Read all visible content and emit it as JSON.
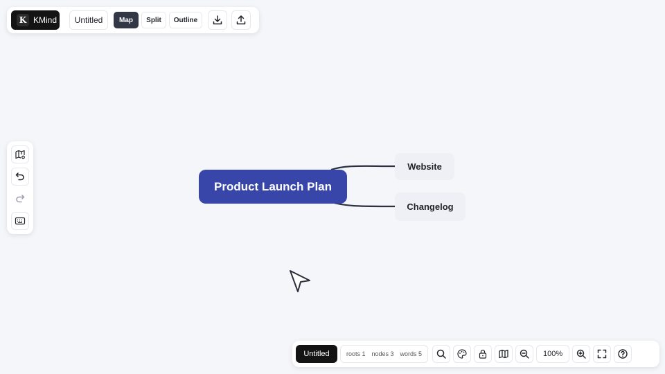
{
  "toolbar": {
    "brand_letter": "K",
    "brand_name": "KMind",
    "doc_title": "Untitled",
    "views": [
      "Map",
      "Split",
      "Outline"
    ],
    "active_view": "Map",
    "download_icon": "download-icon",
    "upload_icon": "upload-icon"
  },
  "left_toolbar": {
    "icons": [
      "map-settings-icon",
      "undo-icon",
      "redo-icon",
      "keyboard-icon"
    ]
  },
  "mindmap": {
    "root": "Product Launch Plan",
    "children": [
      "Website",
      "Changelog"
    ]
  },
  "bottom_bar": {
    "file_name": "Untitled",
    "stats": {
      "roots": "roots 1",
      "nodes": "nodes 3",
      "words": "words 5"
    },
    "zoom": "100%",
    "icons": [
      "search-icon",
      "palette-icon",
      "lock-icon",
      "map-icon",
      "zoom-out-icon",
      "zoom-in-icon",
      "fullscreen-icon",
      "help-icon"
    ]
  },
  "colors": {
    "background": "#f5f6fa",
    "root_node": "#3746a8",
    "child_node": "#eef0f6",
    "active_view": "#323846",
    "brand": "#141414"
  }
}
